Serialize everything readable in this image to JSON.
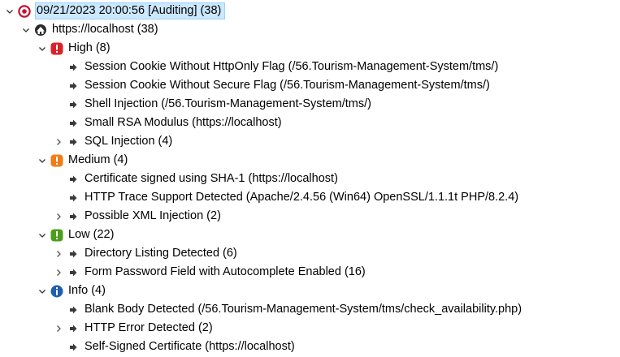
{
  "scan": {
    "label": "09/21/2023 20:00:56 [Auditing]  (38)",
    "host": {
      "label": "https://localhost (38)",
      "groups": [
        {
          "label": "High (8)",
          "color": "#d9232b",
          "symbol": "!",
          "items": [
            {
              "label": "Session Cookie Without HttpOnly Flag  (/56.Tourism-Management-System/tms/)",
              "expandable": false
            },
            {
              "label": "Session Cookie Without Secure Flag  (/56.Tourism-Management-System/tms/)",
              "expandable": false
            },
            {
              "label": "Shell Injection (/56.Tourism-Management-System/tms/)",
              "expandable": false
            },
            {
              "label": "Small RSA Modulus (https://localhost)",
              "expandable": false
            },
            {
              "label": "SQL Injection (4)",
              "expandable": true
            }
          ]
        },
        {
          "label": "Medium (4)",
          "color": "#f07d1a",
          "symbol": "!",
          "items": [
            {
              "label": "Certificate signed using SHA-1 (https://localhost)",
              "expandable": false
            },
            {
              "label": "HTTP Trace Support Detected (Apache/2.4.56 (Win64) OpenSSL/1.1.1t PHP/8.2.4)",
              "expandable": false
            },
            {
              "label": "Possible XML Injection (2)",
              "expandable": true
            }
          ]
        },
        {
          "label": "Low (22)",
          "color": "#4c9e1c",
          "symbol": "!",
          "items": [
            {
              "label": "Directory Listing Detected (6)",
              "expandable": true
            },
            {
              "label": "Form Password Field with Autocomplete Enabled (16)",
              "expandable": true
            }
          ]
        },
        {
          "label": "Info (4)",
          "color": "#1f5fb0",
          "symbol": "i",
          "items": [
            {
              "label": "Blank Body Detected (/56.Tourism-Management-System/tms/check_availability.php)",
              "expandable": false
            },
            {
              "label": "HTTP Error Detected (2)",
              "expandable": true
            },
            {
              "label": "Self-Signed Certificate (https://localhost)",
              "expandable": false
            }
          ]
        }
      ]
    }
  }
}
